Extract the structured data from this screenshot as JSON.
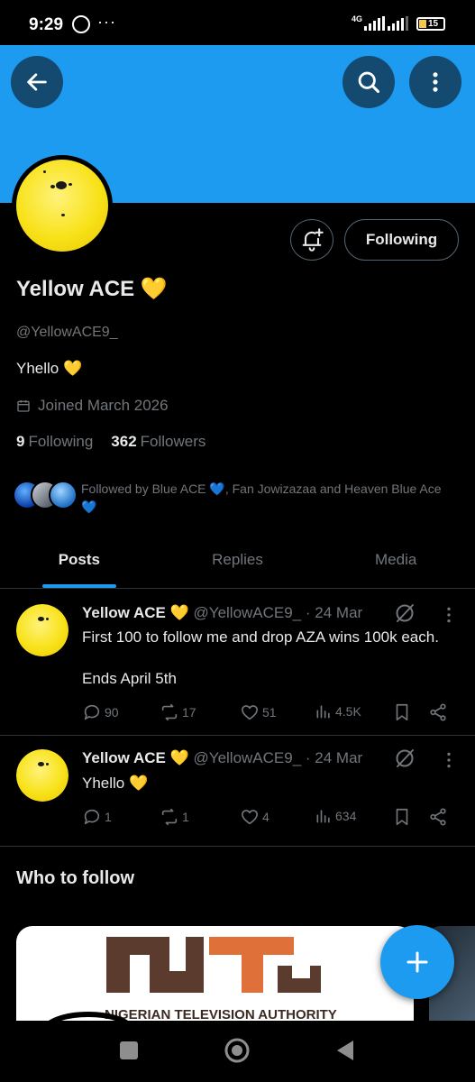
{
  "status_bar": {
    "time": "9:29",
    "dots": "···",
    "network": "4G",
    "battery": "15"
  },
  "profile": {
    "name": "Yellow ACE 💛",
    "handle": "@YellowACE9_",
    "bio": "Yhello 💛",
    "joined": "Joined March 2026",
    "following_count": "9",
    "following_label": "Following",
    "followers_count": "362",
    "followers_label": "Followers",
    "follow_button_label": "Following",
    "followed_by": "Followed by Blue ACE 💙, Fan Jowizazaa and Heaven Blue Ace 💙"
  },
  "tabs": [
    "Posts",
    "Replies",
    "Media"
  ],
  "tweets": [
    {
      "name": "Yellow ACE 💛",
      "handle": "@YellowACE9_",
      "time": "· 24 Mar",
      "line1": "First 100 to follow me and drop AZA wins 100k each.",
      "line2": "Ends April 5th",
      "replies": "90",
      "retweets": "17",
      "likes": "51",
      "views": "4.5K"
    },
    {
      "name": "Yellow ACE 💛",
      "handle": "@YellowACE9_",
      "time": "· 24 Mar",
      "line1": "Yhello 💛",
      "line2": "",
      "replies": "1",
      "retweets": "1",
      "likes": "4",
      "views": "634"
    }
  ],
  "who_to_follow": {
    "title": "Who to follow",
    "card_logo_text": "NIGERIAN TELEVISION AUTHORITY"
  },
  "colors": {
    "accent": "#1d9bf0",
    "background": "#000000",
    "muted": "#71767b",
    "text": "#e7e9ea",
    "ntа_brown": "#5a3b2e",
    "nta_orange": "#e0703a"
  },
  "icons": [
    "back-arrow-icon",
    "search-icon",
    "more-vertical-icon",
    "bell-plus-icon",
    "calendar-icon",
    "reply-icon",
    "retweet-icon",
    "like-icon",
    "views-icon",
    "bookmark-icon",
    "share-icon",
    "grok-icon",
    "plus-icon"
  ]
}
